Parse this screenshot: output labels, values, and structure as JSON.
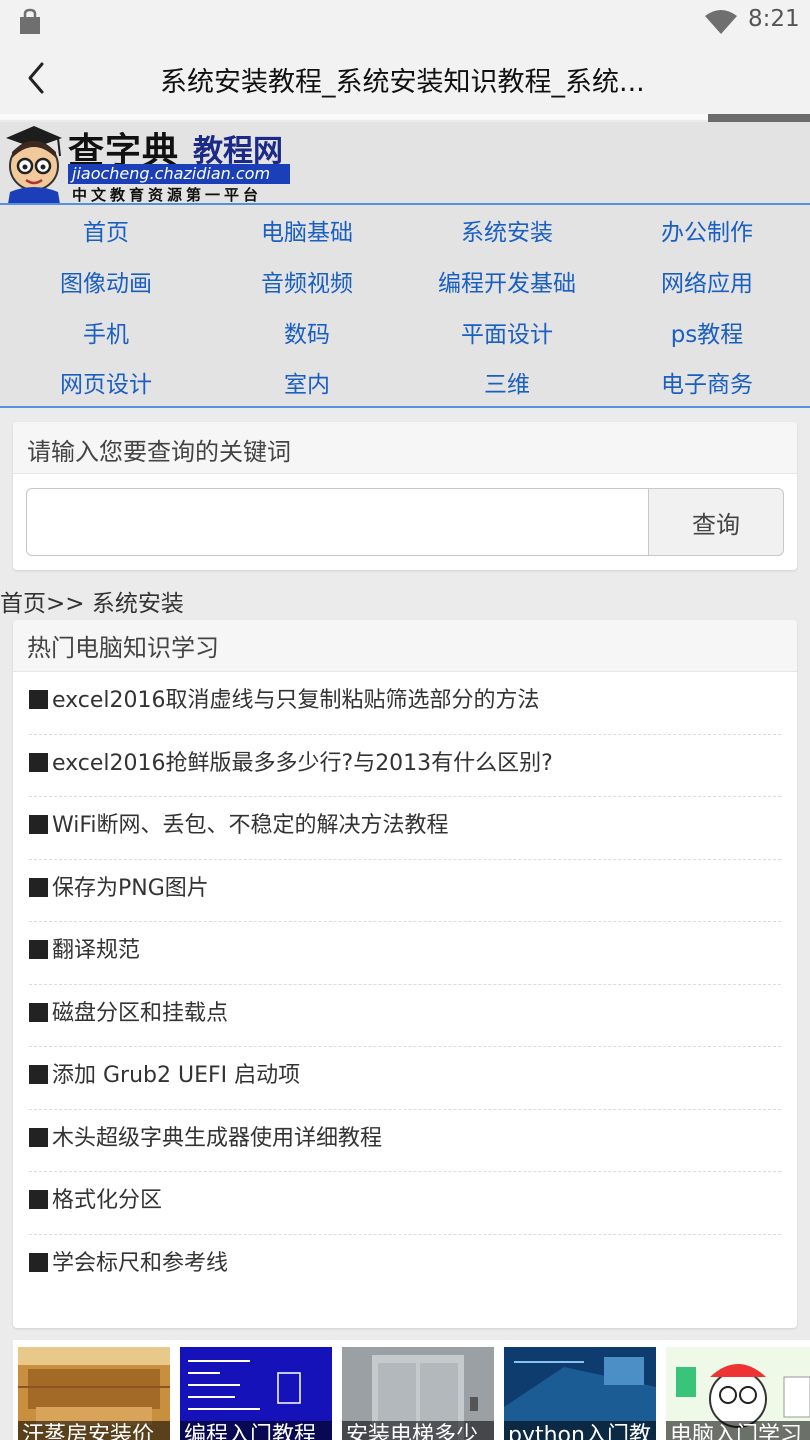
{
  "status_bar": {
    "time": "8:21"
  },
  "title_bar": {
    "title": "系统安装教程_系统安装知识教程_系统..."
  },
  "logo": {
    "main_text": "查字典",
    "sub_text": "教程网",
    "domain": "jiaocheng.chazidian.com",
    "slogan": "中文教育资源第一平台"
  },
  "nav": {
    "items": [
      {
        "label": "首页"
      },
      {
        "label": "电脑基础"
      },
      {
        "label": "系统安装"
      },
      {
        "label": "办公制作"
      },
      {
        "label": "图像动画"
      },
      {
        "label": "音频视频"
      },
      {
        "label": "编程开发基础"
      },
      {
        "label": "网络应用"
      },
      {
        "label": "手机"
      },
      {
        "label": "数码"
      },
      {
        "label": "平面设计"
      },
      {
        "label": "ps教程"
      },
      {
        "label": "网页设计"
      },
      {
        "label": "室内"
      },
      {
        "label": "三维"
      },
      {
        "label": "电子商务"
      }
    ]
  },
  "search": {
    "heading": "请输入您要查询的关键词",
    "value": "",
    "button_label": "查询"
  },
  "breadcrumb": {
    "text": "首页>> 系统安装"
  },
  "hot": {
    "heading": "热门电脑知识学习",
    "items": [
      {
        "label": "excel2016取消虚线与只复制粘贴筛选部分的方法"
      },
      {
        "label": "excel2016抢鲜版最多多少行?与2013有什么区别?"
      },
      {
        "label": "WiFi断网、丢包、不稳定的解决方法教程"
      },
      {
        "label": "保存为PNG图片"
      },
      {
        "label": "翻译规范"
      },
      {
        "label": "磁盘分区和挂载点"
      },
      {
        "label": "添加 Grub2 UEFI 启动项"
      },
      {
        "label": "木头超级字典生成器使用详细教程"
      },
      {
        "label": "格式化分区"
      },
      {
        "label": "学会标尺和参考线"
      }
    ]
  },
  "thumbs": [
    {
      "caption": "汗蒸房安装价"
    },
    {
      "caption": "编程入门教程"
    },
    {
      "caption": "安装电梯多少"
    },
    {
      "caption": "python入门教"
    },
    {
      "caption": "电脑入门学习"
    }
  ],
  "colors": {
    "accent": "#1a5fc2",
    "nav_border": "#5a8fe0"
  }
}
